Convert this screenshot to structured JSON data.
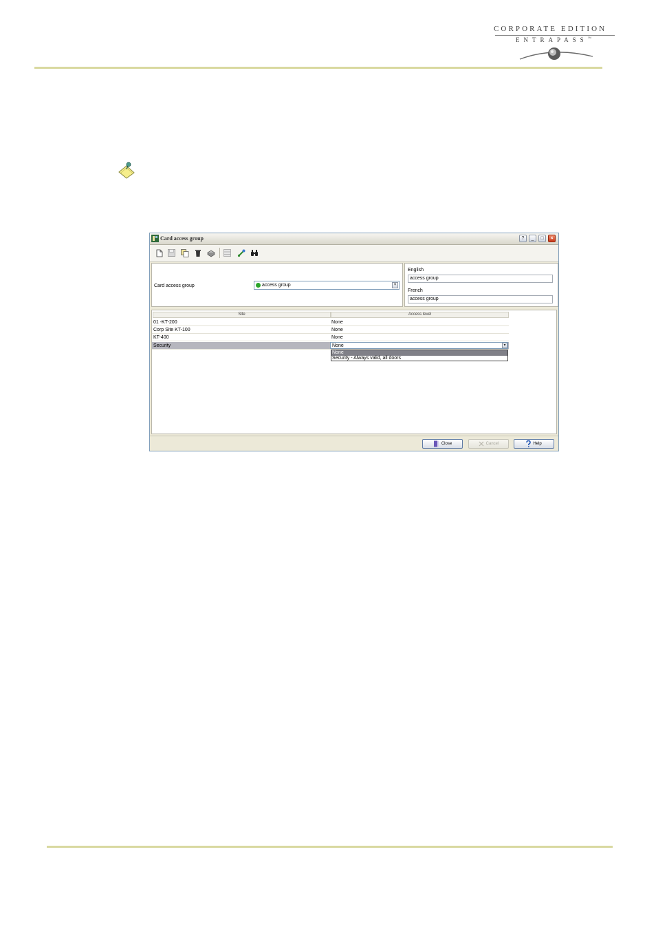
{
  "header": {
    "brand_line1": "CORPORATE EDITION",
    "brand_line2": "ENTRAPASS",
    "brand_tm": "™"
  },
  "icons": {
    "note": "note-pin-icon",
    "app": "entrapass-app-icon",
    "logo": "globe-swoosh-icon"
  },
  "colors": {
    "rule": "#d9d9a0",
    "window_bg": "#ece9d8",
    "selected_row": "#b6b6be",
    "close_button": "#c8391b",
    "status_green": "#2aa52a"
  },
  "window": {
    "title": "Card access group",
    "title_buttons": [
      "?",
      "_",
      "□",
      "×"
    ],
    "toolbar": [
      "new-icon",
      "save-icon",
      "copy-icon",
      "delete-icon",
      "print-icon",
      "grid-icon",
      "link-icon",
      "find-icon"
    ],
    "card_access_group_label": "Card access group",
    "card_access_group_value": "access group",
    "english_label": "English",
    "english_value": "access group",
    "french_label": "French",
    "french_value": "access group",
    "table": {
      "columns": [
        "Site",
        "Access level"
      ],
      "rows": [
        {
          "site": "01 -KT-200",
          "level": "None"
        },
        {
          "site": "Corp Site KT-100",
          "level": "None"
        },
        {
          "site": "KT-400",
          "level": "None"
        },
        {
          "site": "Security",
          "level": "None"
        }
      ],
      "dropdown_options": [
        "None",
        "Security - Always valid, all doors"
      ]
    },
    "buttons": {
      "close": "Close",
      "cancel": "Cancel",
      "help": "Help"
    }
  }
}
